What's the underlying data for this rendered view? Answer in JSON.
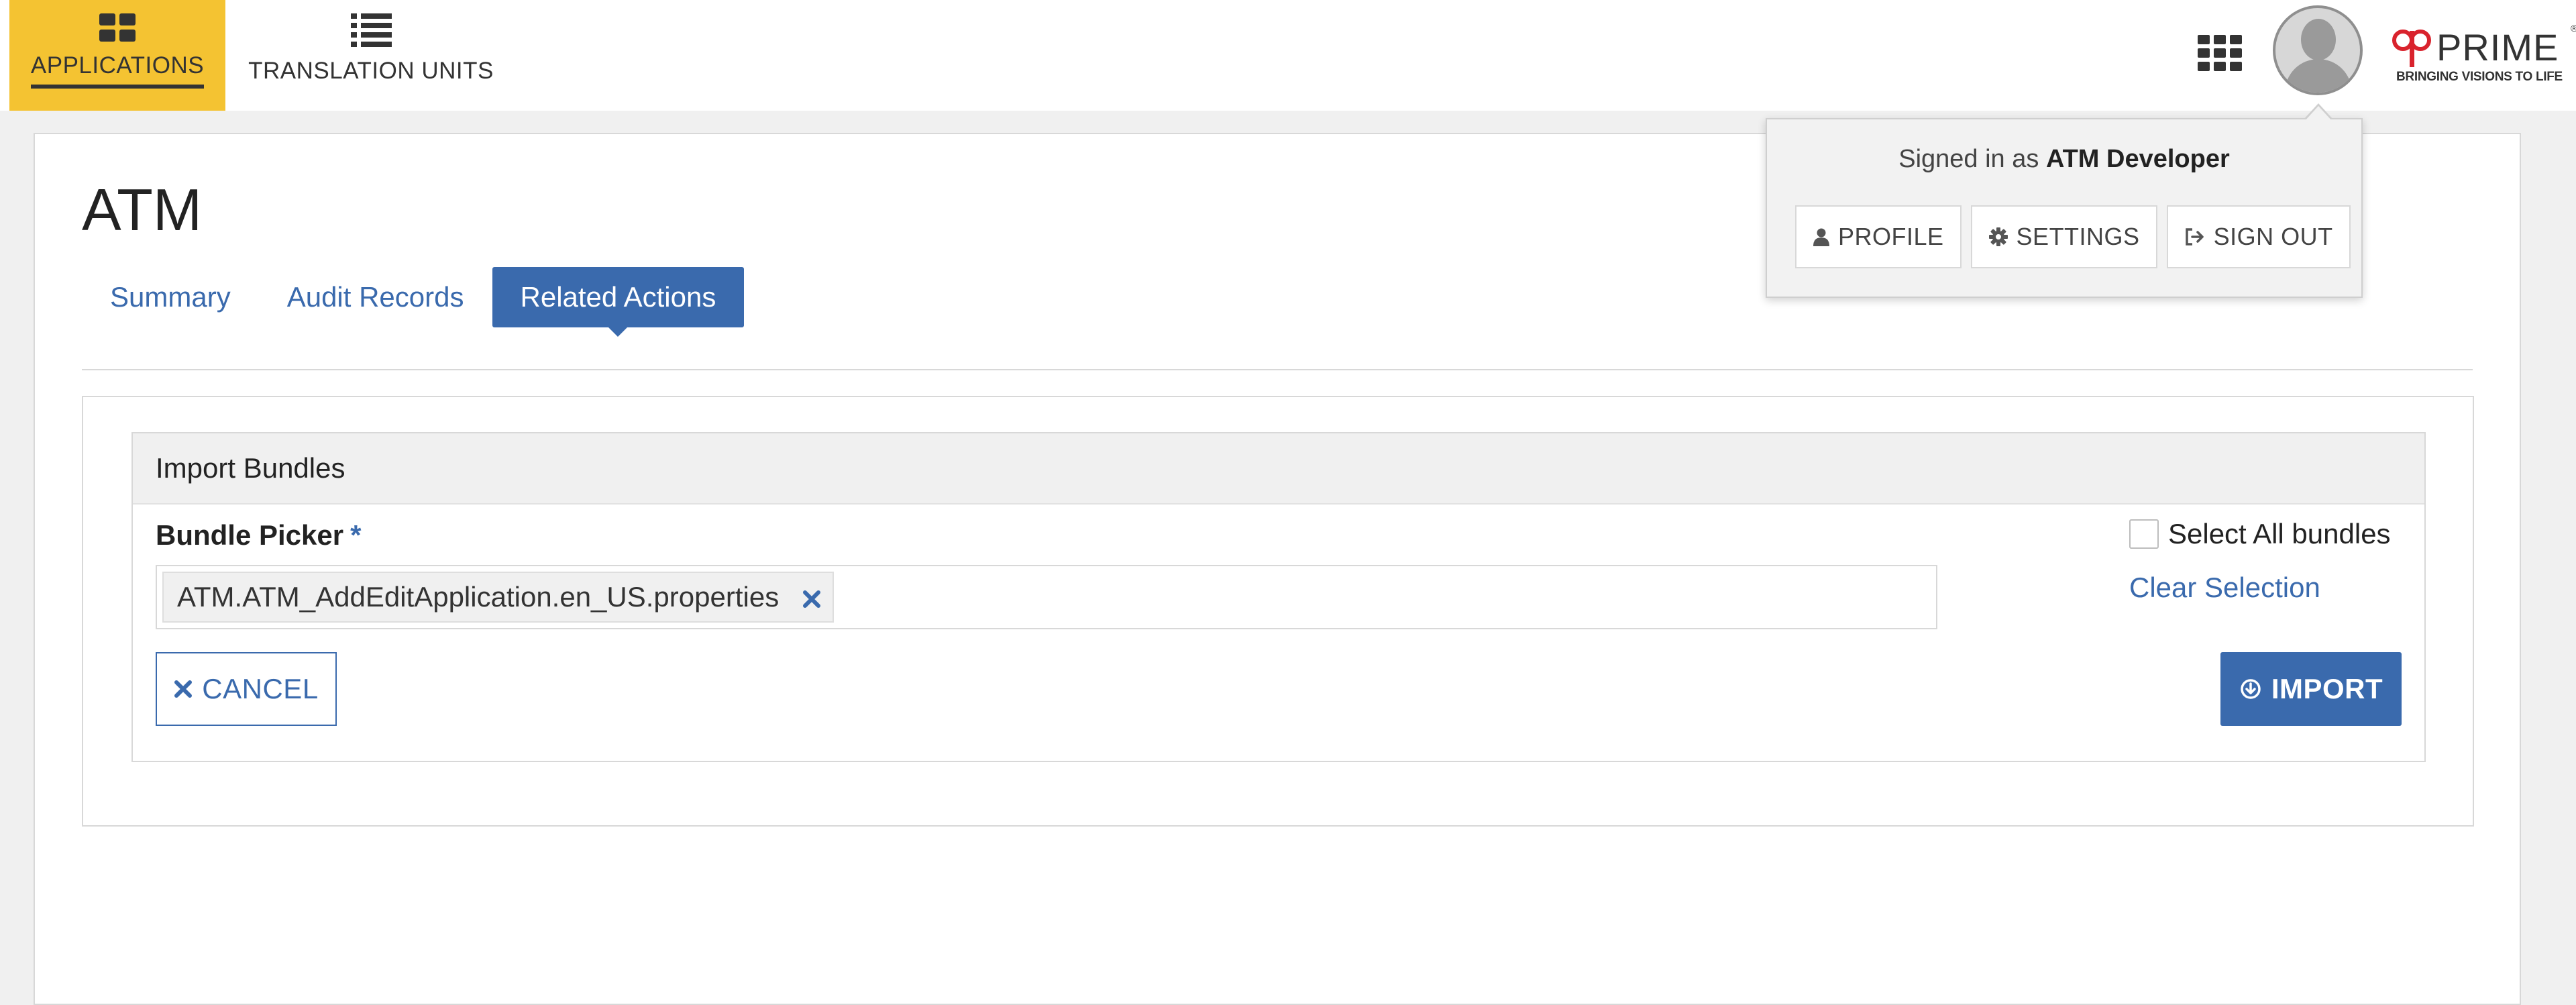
{
  "nav": {
    "applications_label": "APPLICATIONS",
    "translation_units_label": "TRANSLATION UNITS",
    "active_color": "#f4c332",
    "icons": [
      "applications-icon",
      "translation-units-icon",
      "apps-grid-icon",
      "avatar"
    ]
  },
  "logo": {
    "brand": "PRIME",
    "registered": "®",
    "tagline": "BRINGING VISIONS TO LIFE"
  },
  "page": {
    "title": "ATM",
    "tabs": [
      {
        "label": "Summary",
        "active": false
      },
      {
        "label": "Audit Records",
        "active": false
      },
      {
        "label": "Related Actions",
        "active": true
      }
    ]
  },
  "import_panel": {
    "heading": "Import Bundles",
    "field_label": "Bundle Picker",
    "required_marker": "*",
    "selected_bundle": "ATM.ATM_AddEditApplication.en_US.properties",
    "select_all_label": "Select All bundles",
    "select_all_checked": false,
    "clear_selection_label": "Clear Selection",
    "cancel_label": "CANCEL",
    "import_label": "IMPORT"
  },
  "user_menu": {
    "signed_in_prefix": "Signed in as",
    "user_name": "ATM Developer",
    "profile_label": "PROFILE",
    "settings_label": "SETTINGS",
    "sign_out_label": "SIGN OUT"
  },
  "colors": {
    "accent": "#3a6aad",
    "nav_active": "#f4c332",
    "logo_red": "#d9232d"
  }
}
